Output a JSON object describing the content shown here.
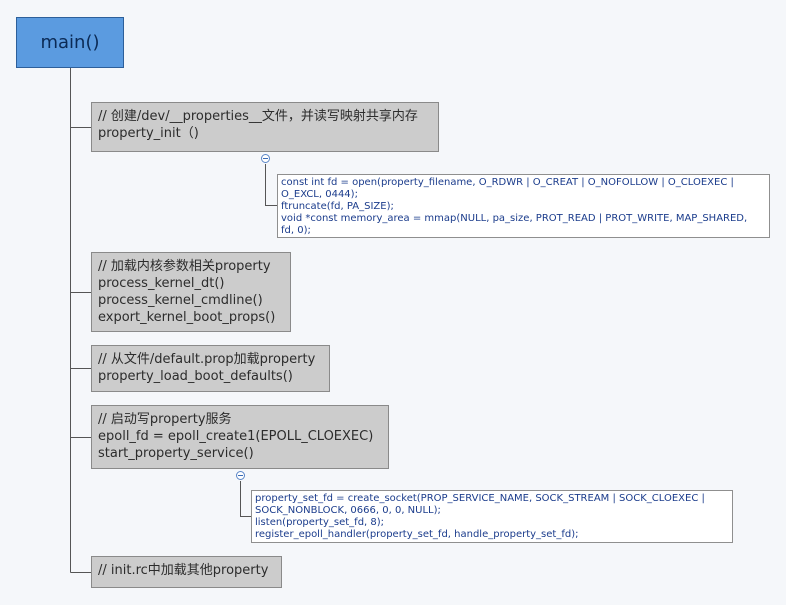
{
  "root": {
    "label": "main()"
  },
  "steps": [
    {
      "lines": [
        "// 创建/dev/__properties__文件，并读写映射共享内存",
        "property_init（)"
      ],
      "detail": [
        "const int fd = open(property_filename, O_RDWR | O_CREAT | O_NOFOLLOW | O_CLOEXEC |",
        "O_EXCL, 0444);",
        "ftruncate(fd, PA_SIZE);",
        "void *const memory_area = mmap(NULL, pa_size, PROT_READ | PROT_WRITE, MAP_SHARED,",
        "fd, 0);"
      ]
    },
    {
      "lines": [
        "// 加载内核参数相关property",
        "process_kernel_dt()",
        "process_kernel_cmdline()",
        "export_kernel_boot_props()"
      ]
    },
    {
      "lines": [
        "// 从文件/default.prop加载property",
        "property_load_boot_defaults()"
      ]
    },
    {
      "lines": [
        "// 启动写property服务",
        "epoll_fd = epoll_create1(EPOLL_CLOEXEC)",
        "start_property_service()"
      ],
      "detail": [
        "property_set_fd = create_socket(PROP_SERVICE_NAME, SOCK_STREAM | SOCK_CLOEXEC |",
        "SOCK_NONBLOCK, 0666, 0, 0, NULL);",
        "listen(property_set_fd, 8);",
        "register_epoll_handler(property_set_fd, handle_property_set_fd);"
      ]
    },
    {
      "lines": [
        "// init.rc中加载其他property"
      ]
    }
  ]
}
